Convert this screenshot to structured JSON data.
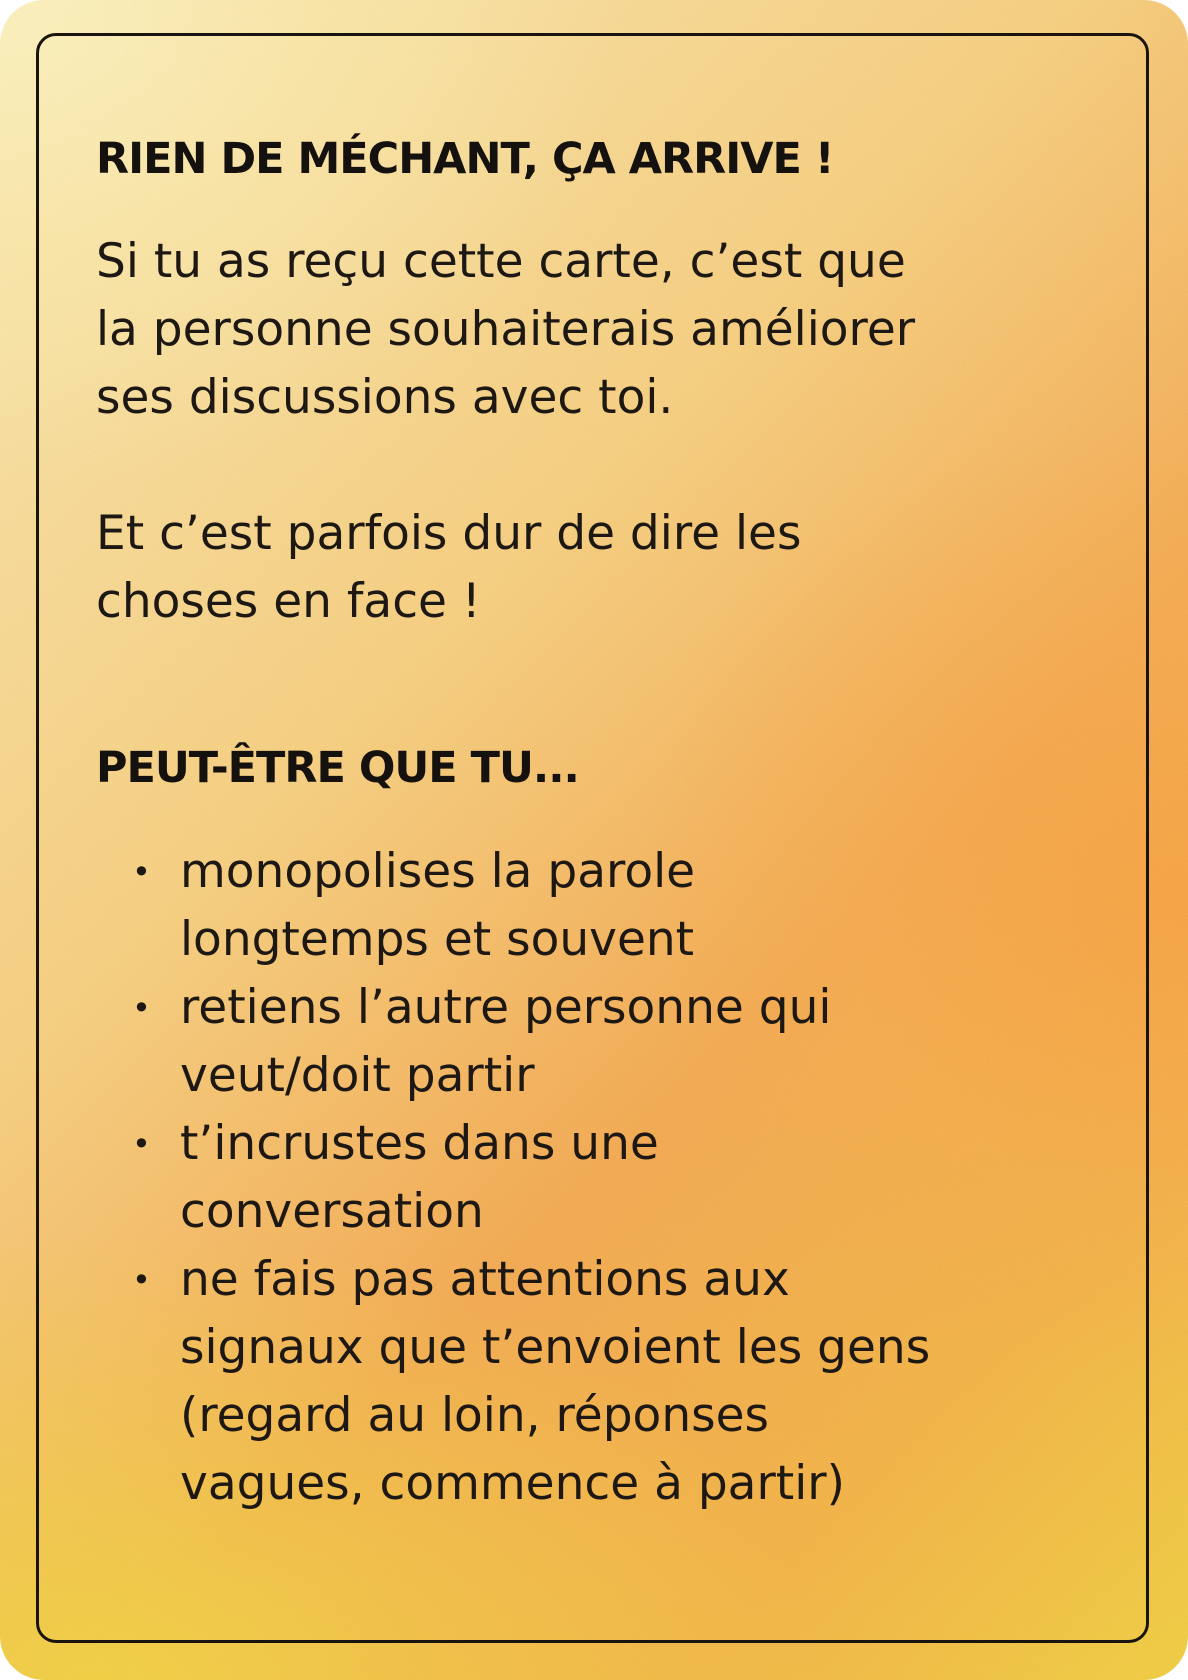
{
  "card": {
    "heading_1": "RIEN DE MÉCHANT, ÇA ARRIVE !",
    "paragraph_1": [
      "Si tu as reçu cette carte, c’est que",
      "la personne souhaiterais améliorer",
      "ses discussions avec toi."
    ],
    "paragraph_2": [
      "Et c’est parfois dur de dire les",
      "choses en face !"
    ],
    "heading_2": "PEUT-ÊTRE QUE TU...",
    "bullet_symbol": "•",
    "list": [
      {
        "lines": [
          "monopolises la parole",
          "longtemps et souvent"
        ]
      },
      {
        "lines": [
          "retiens l’autre personne qui",
          "veut/doit partir"
        ]
      },
      {
        "lines": [
          "t’incrustes dans une",
          "conversation"
        ]
      },
      {
        "lines": [
          "ne fais pas attentions aux",
          "signaux que t’envoient les gens",
          "(regard au loin, réponses",
          "vagues, commence à partir)"
        ]
      }
    ],
    "colors": {
      "text": "#1d1813",
      "border": "#1a1410",
      "gradient_light": "#fbe9b0",
      "gradient_orange": "#f6a94c",
      "gradient_yellow": "#f3cf3c"
    }
  }
}
